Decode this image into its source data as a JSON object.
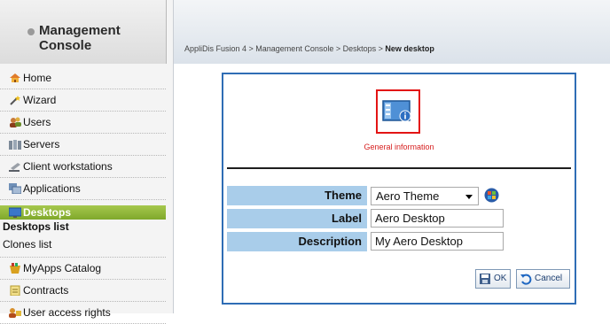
{
  "sidebar": {
    "title": "Management Console",
    "items": [
      {
        "label": "Home",
        "icon": "home-icon"
      },
      {
        "label": "Wizard",
        "icon": "wand-icon"
      },
      {
        "label": "Users",
        "icon": "users-icon"
      },
      {
        "label": "Servers",
        "icon": "servers-icon"
      },
      {
        "label": "Client workstations",
        "icon": "workstation-icon"
      },
      {
        "label": "Applications",
        "icon": "applications-icon"
      },
      {
        "label": "Desktops",
        "icon": "desktops-icon"
      },
      {
        "label": "MyApps Catalog",
        "icon": "catalog-icon"
      },
      {
        "label": "Contracts",
        "icon": "contracts-icon"
      },
      {
        "label": "User access rights",
        "icon": "access-rights-icon"
      }
    ],
    "desktops_sub": [
      "Desktops list",
      "Clones list"
    ]
  },
  "breadcrumb": {
    "path": "AppliDis Fusion 4 > Management Console > Desktops > ",
    "current": "New desktop"
  },
  "panel": {
    "info_caption": "General information",
    "fields": {
      "theme_label": "Theme",
      "theme_value": "Aero Theme",
      "label_label": "Label",
      "label_value": "Aero Desktop",
      "description_label": "Description",
      "description_value": "My Aero Desktop"
    },
    "buttons": {
      "ok": "OK",
      "cancel": "Cancel"
    }
  },
  "colors": {
    "active_nav": "#8db53a",
    "panel_border": "#2f6db5",
    "field_label_bg": "#a9cdea",
    "caption_red": "#d62020"
  }
}
